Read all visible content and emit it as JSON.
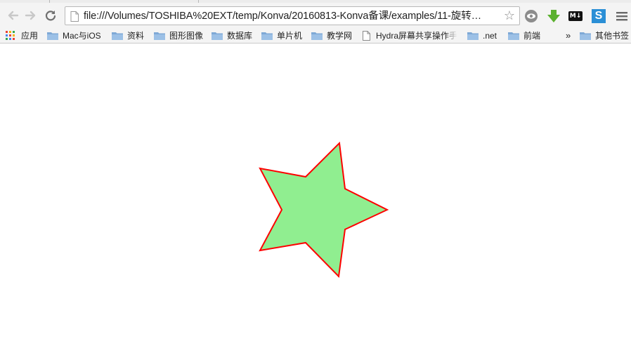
{
  "browser": {
    "url": "file:///Volumes/TOSHIBA%20EXT/temp/Konva/20160813-Konva备课/examples/11-旋转…",
    "icons": {
      "back": "arrow-left-icon",
      "forward": "arrow-right-icon",
      "reload": "reload-icon",
      "page": "document-icon",
      "bookmark_star": "star-icon",
      "menu": "hamburger-menu-icon"
    }
  },
  "extensions": [
    {
      "name": "eye-extension-icon"
    },
    {
      "name": "download-extension-icon"
    },
    {
      "name": "markdown-extension-icon",
      "text": "M↓"
    },
    {
      "name": "s-extension-icon",
      "text": "S"
    }
  ],
  "bookmarks": {
    "apps_label": "应用",
    "items": [
      {
        "label": "Mac与iOS",
        "icon": "folder-icon"
      },
      {
        "label": "资料",
        "icon": "folder-icon"
      },
      {
        "label": "图形图像",
        "icon": "folder-icon"
      },
      {
        "label": "数据库",
        "icon": "folder-icon"
      },
      {
        "label": "单片机",
        "icon": "folder-icon"
      },
      {
        "label": "教学网",
        "icon": "folder-icon"
      },
      {
        "label": "Hydra屏幕共享操作手",
        "icon": "page-icon"
      },
      {
        "label": ".net",
        "icon": "folder-icon"
      },
      {
        "label": "前端",
        "icon": "folder-icon"
      }
    ],
    "overflow": "»",
    "other_label": "其他书签"
  },
  "canvas": {
    "shape": "star",
    "num_points": 5,
    "fill": "#90EE90",
    "stroke": "#ff0000",
    "background": "#ffffff"
  }
}
